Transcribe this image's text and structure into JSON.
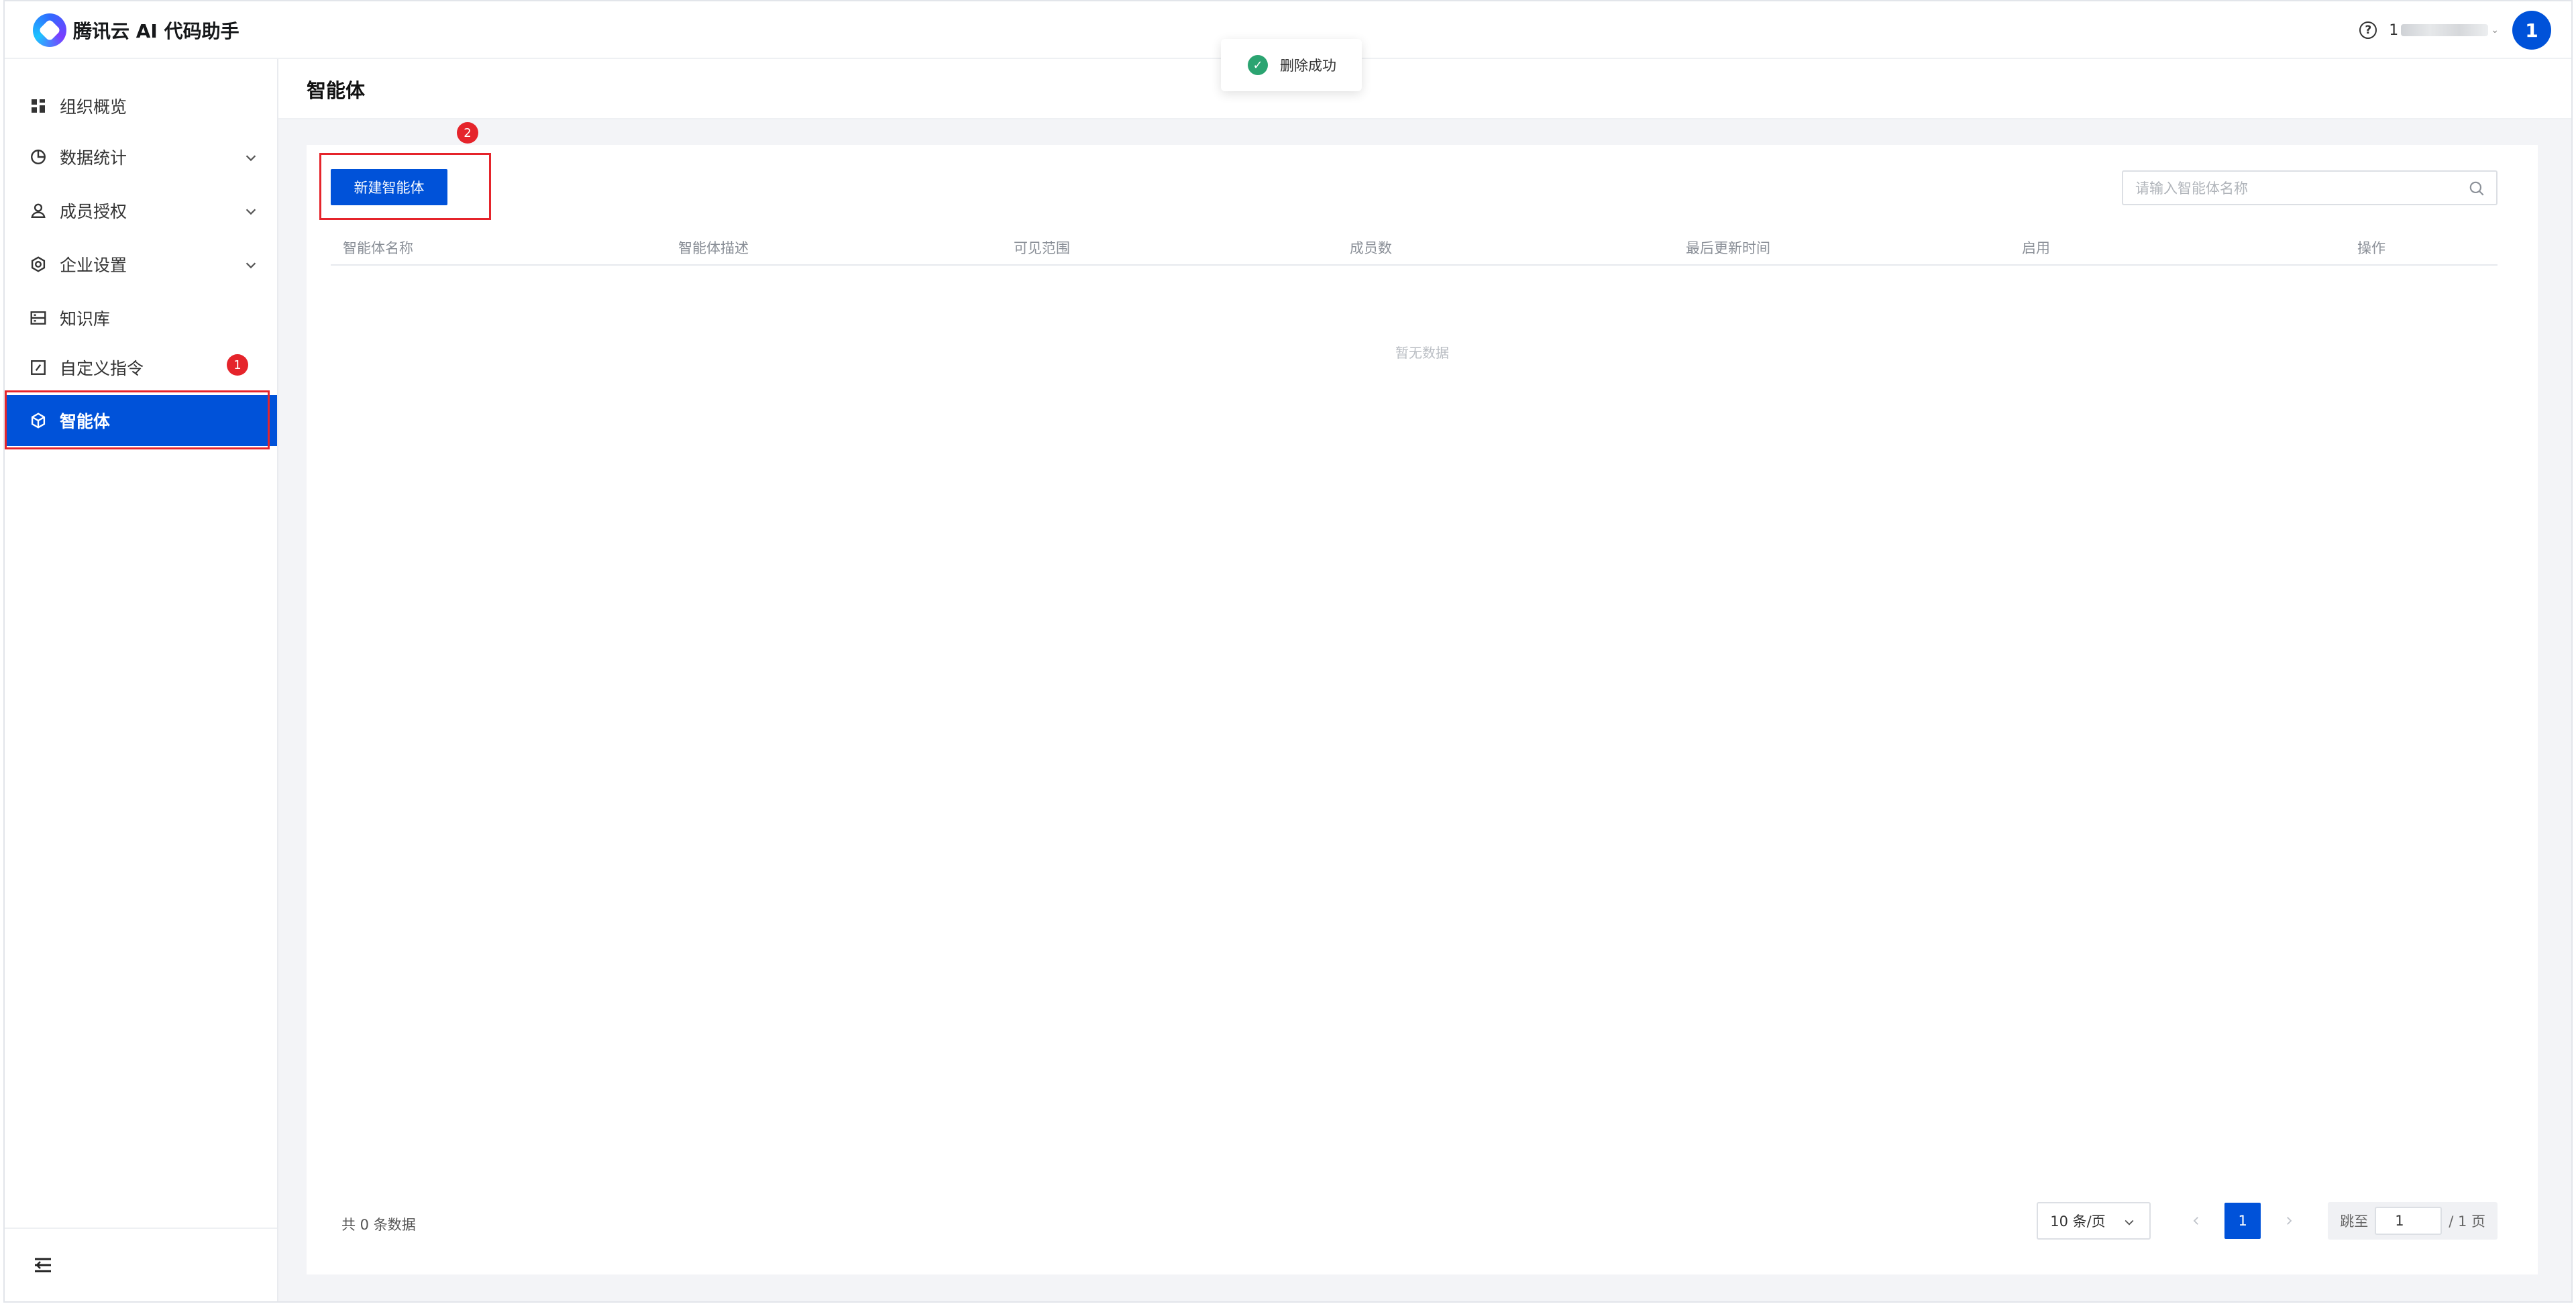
{
  "app": {
    "title": "腾讯云 AI 代码助手"
  },
  "topbar": {
    "help_icon": "help-circle-icon",
    "user_name_prefix": "1",
    "avatar_letter": "1"
  },
  "toast": {
    "message": "删除成功",
    "icon": "check-circle-icon"
  },
  "sidebar": {
    "items": [
      {
        "label": "组织概览",
        "icon": "dashboard-grid-icon",
        "expandable": false
      },
      {
        "label": "数据统计",
        "icon": "pie-chart-icon",
        "expandable": true
      },
      {
        "label": "成员授权",
        "icon": "user-icon",
        "expandable": true
      },
      {
        "label": "企业设置",
        "icon": "settings-icon",
        "expandable": true
      },
      {
        "label": "知识库",
        "icon": "database-icon",
        "expandable": false
      },
      {
        "label": "自定义指令",
        "icon": "edit-square-icon",
        "expandable": false
      },
      {
        "label": "智能体",
        "icon": "cube-icon",
        "expandable": false,
        "active": true
      }
    ],
    "annotation_badge": "1",
    "collapse_icon": "collapse-menu-icon"
  },
  "page": {
    "title": "智能体"
  },
  "toolbar": {
    "new_button_label": "新建智能体",
    "annotation_badge": "2"
  },
  "search": {
    "placeholder": "请输入智能体名称"
  },
  "table": {
    "columns": [
      "智能体名称",
      "智能体描述",
      "可见范围",
      "成员数",
      "最后更新时间",
      "启用",
      "操作"
    ],
    "rows": [],
    "empty_text": "暂无数据"
  },
  "pagination": {
    "total_text": "共 0 条数据",
    "page_size": "10 条/页",
    "current_page": "1",
    "jump_label": "跳至",
    "jump_value": "1",
    "total_pages_text": "/ 1 页"
  },
  "colors": {
    "primary": "#0052d9",
    "highlight_red": "#e5242b",
    "success": "#2ba471"
  }
}
